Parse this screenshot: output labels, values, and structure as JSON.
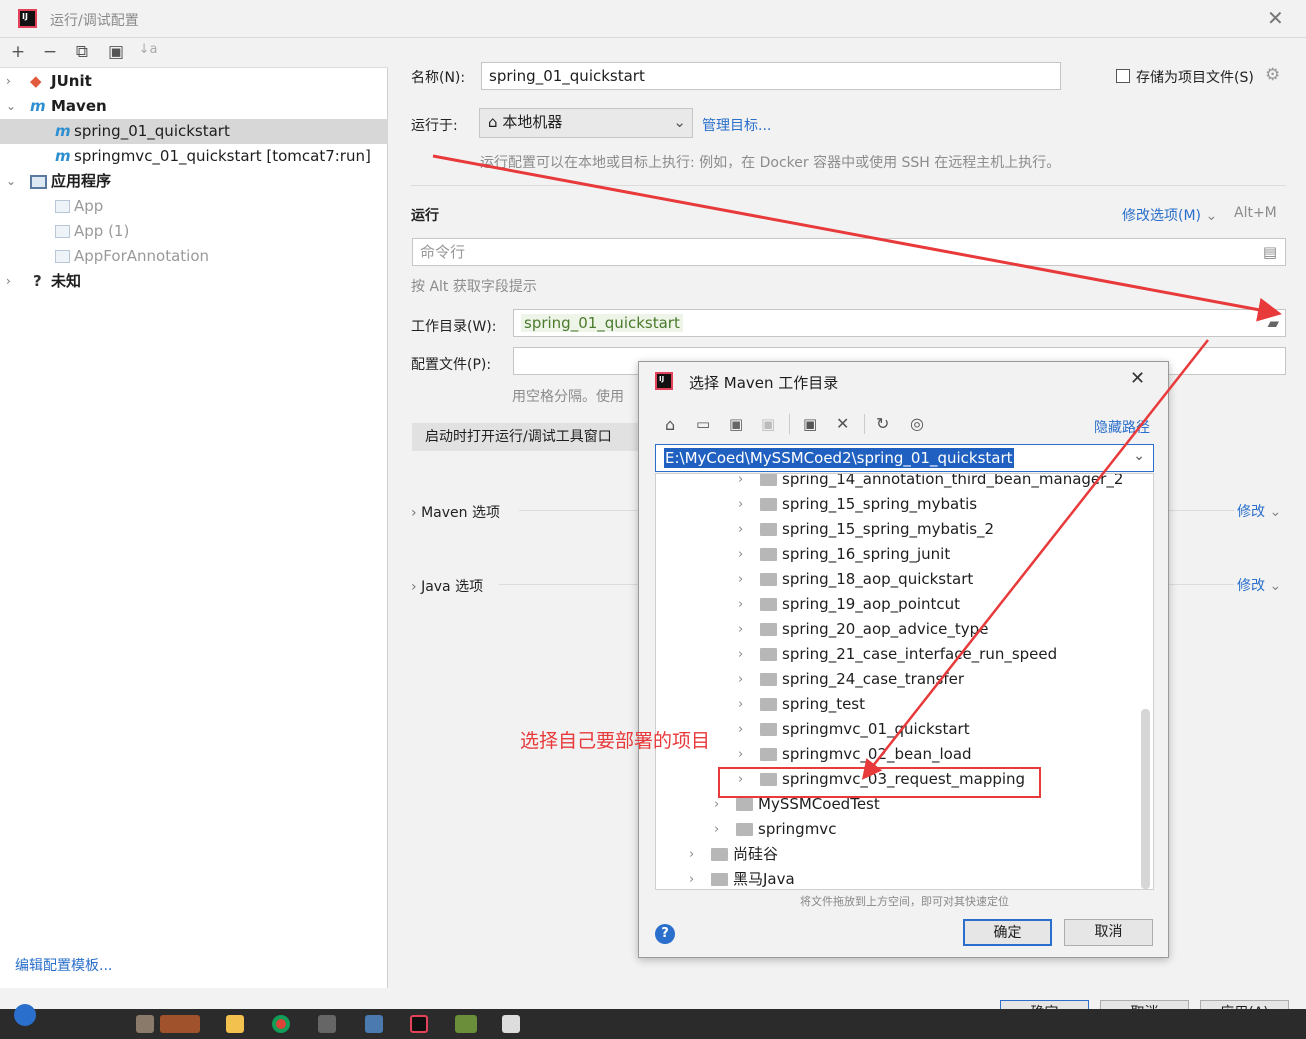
{
  "window": {
    "title": "运行/调试配置"
  },
  "left_toolbar": {
    "add": "+",
    "remove": "−",
    "copy": "⧉",
    "folder": "▣",
    "sort": "↓a"
  },
  "tree": {
    "items": [
      {
        "label": "JUnit",
        "icon": "junit-icon"
      },
      {
        "label": "Maven",
        "icon": "maven-icon"
      },
      {
        "label": "spring_01_quickstart",
        "icon": "maven-icon"
      },
      {
        "label": "springmvc_01_quickstart [tomcat7:run]",
        "icon": "maven-icon"
      },
      {
        "label": "应用程序",
        "icon": "application-icon"
      },
      {
        "label": "App",
        "icon": "app-icon"
      },
      {
        "label": "App (1)",
        "icon": "app-icon"
      },
      {
        "label": "AppForAnnotation",
        "icon": "app-icon"
      },
      {
        "label": "未知",
        "icon": "question-icon"
      }
    ],
    "edit_templates": "编辑配置模板..."
  },
  "form": {
    "name_label": "名称(N):",
    "name_value": "spring_01_quickstart",
    "store_label": "存储为项目文件(S)",
    "run_on_label": "运行于:",
    "run_on_value": "本地机器",
    "manage_targets": "管理目标...",
    "run_on_hint": "运行配置可以在本地或目标上执行: 例如，在 Docker 容器中或使用 SSH 在远程主机上执行。",
    "run_section": "运行",
    "modify_options": "修改选项(M)",
    "modify_shortcut": "Alt+M",
    "command_placeholder": "命令行",
    "alt_hint": "按 Alt 获取字段提示",
    "workdir_label": "工作目录(W):",
    "workdir_value": "spring_01_quickstart",
    "profiles_label": "配置文件(P):",
    "profiles_hint": "用空格分隔。使用",
    "open_tool_window": "启动时打开运行/调试工具窗口",
    "maven_options": "Maven 选项",
    "java_options": "Java 选项",
    "modify": "修改"
  },
  "dialog": {
    "title": "选择 Maven 工作目录",
    "hide_path": "隐藏路径",
    "path": "E:\\MyCoed\\MySSMCoed2\\spring_01_quickstart",
    "folders": [
      "spring_14_annotation_third_bean_manager_2",
      "spring_15_spring_mybatis",
      "spring_15_spring_mybatis_2",
      "spring_16_spring_junit",
      "spring_18_aop_quickstart",
      "spring_19_aop_pointcut",
      "spring_20_aop_advice_type",
      "spring_21_case_interface_run_speed",
      "spring_24_case_transfer",
      "spring_test",
      "springmvc_01_quickstart",
      "springmvc_02_bean_load",
      "springmvc_03_request_mapping"
    ],
    "parent_folders": [
      "MySSMCoedTest",
      "springmvc"
    ],
    "root_folders": [
      "尚硅谷",
      "黑马Java"
    ],
    "drop_hint": "将文件拖放到上方空间，即可对其快速定位",
    "ok": "确定",
    "cancel": "取消",
    "help": "?"
  },
  "annotation": {
    "text": "选择自己要部署的项目",
    "color": "#e8393b"
  },
  "bottom_buttons": [
    "确定",
    "取消",
    "应用(A)"
  ]
}
